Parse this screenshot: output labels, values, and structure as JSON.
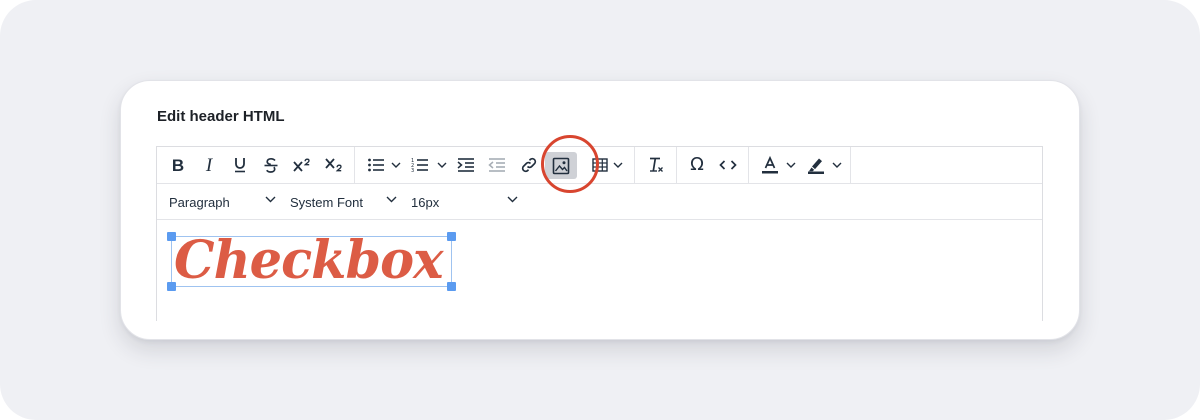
{
  "card": {
    "title": "Edit header HTML"
  },
  "toolbar": {
    "groups": [
      {
        "name": "text-style",
        "buttons": [
          "bold",
          "italic",
          "underline",
          "strikethrough",
          "superscript",
          "subscript"
        ]
      },
      {
        "name": "lists-indent-link-media",
        "buttons": [
          "bullet-list",
          "numbered-list",
          "indent",
          "outdent",
          "link",
          "insert-image",
          "table"
        ]
      },
      {
        "name": "clear",
        "buttons": [
          "clear-formatting"
        ]
      },
      {
        "name": "insert",
        "buttons": [
          "special-character",
          "source-code"
        ]
      },
      {
        "name": "colors",
        "buttons": [
          "text-color",
          "highlight-color"
        ]
      }
    ],
    "active_button": "insert-image",
    "highlight_color": "#d8452f",
    "labels": {
      "bold": "B",
      "italic": "I",
      "special_character": "Ω"
    }
  },
  "formatbar": {
    "block_format": "Paragraph",
    "font_family": "System Font",
    "font_size": "16px"
  },
  "content": {
    "image_alt_logo_text": "Checkbox",
    "logo_color": "#dc5c45",
    "selection_color": "#5b9bf0"
  }
}
